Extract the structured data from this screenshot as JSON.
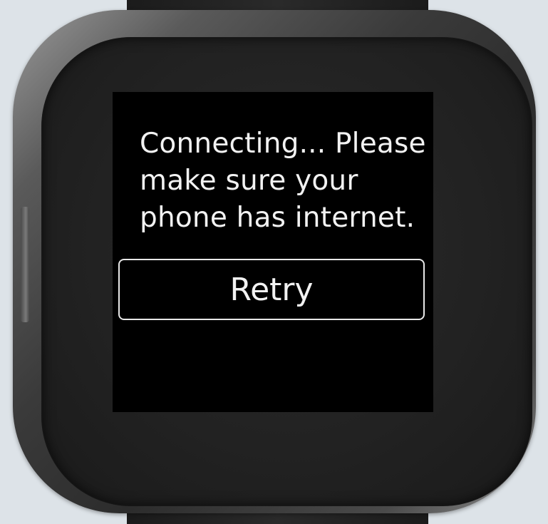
{
  "screen": {
    "message_line1": "Connecting... Please",
    "message_line2": "make sure your",
    "message_line3": "phone has internet.",
    "retry_label": "Retry"
  },
  "colors": {
    "screen_background": "#000000",
    "text": "#f2f2f2",
    "button_border": "#e8e8e8",
    "page_background": "#dde3e8"
  }
}
